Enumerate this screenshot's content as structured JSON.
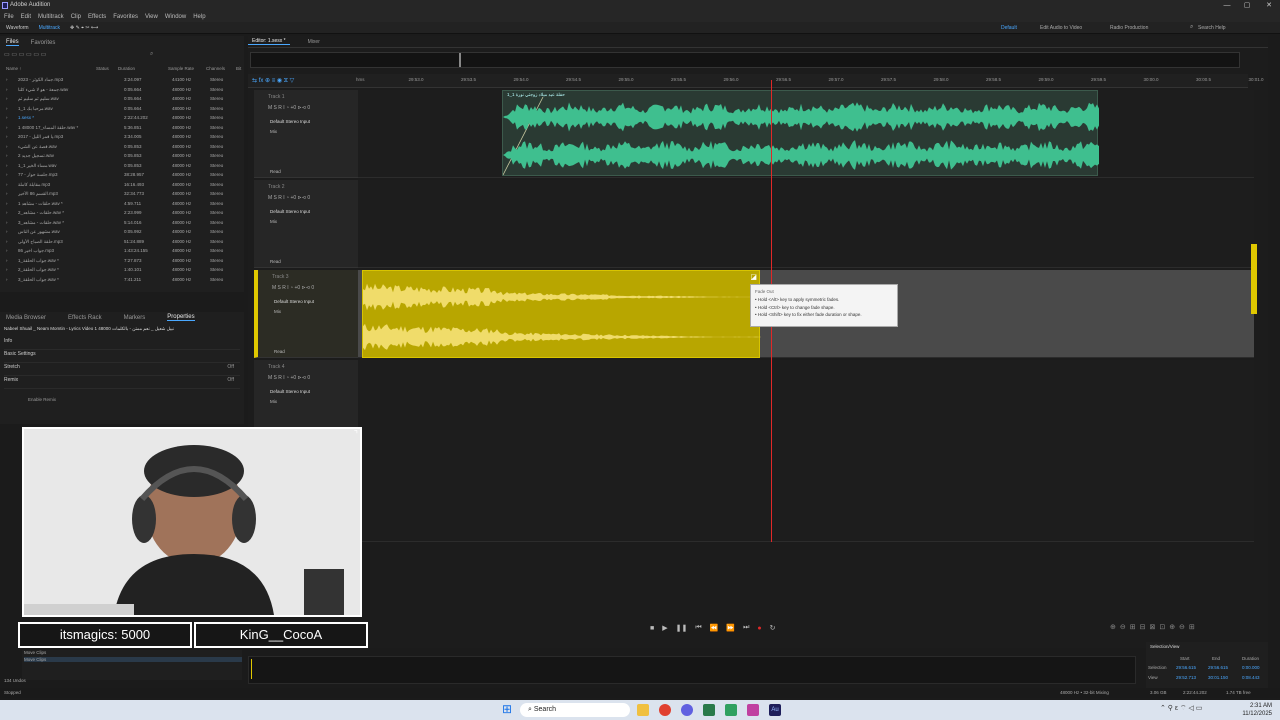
{
  "window": {
    "title": "Adobe Audition",
    "controls": [
      "—",
      "▢",
      "✕"
    ]
  },
  "menu": [
    "File",
    "Edit",
    "Multitrack",
    "Clip",
    "Effects",
    "Favorites",
    "View",
    "Window",
    "Help"
  ],
  "toolbar": {
    "waveform": "Waveform",
    "multitrack": "Multitrack",
    "workspaces": [
      "Default",
      "Edit Audio to Video",
      "Radio Production"
    ],
    "active_workspace": "Default",
    "search_placeholder": "Search Help"
  },
  "files_panel": {
    "tabs": [
      "Files",
      "Favorites"
    ],
    "columns": [
      "Name ↑",
      "Status",
      "Duration",
      "Sample Rate",
      "Channels",
      "Bit"
    ],
    "rows": [
      {
        "name": "2023 - جماد الكوثر.mp3",
        "duration": "3:24.097",
        "rate": "44100 Hz",
        "ch": "Stereo"
      },
      {
        "name": "جمعة - هو لا شيء كلنا.wav",
        "duration": "0:05.664",
        "rate": "48000 Hz",
        "ch": "Stereo"
      },
      {
        "name": "سليم ثم سليم ثم.wav",
        "duration": "0:05.664",
        "rate": "48000 Hz",
        "ch": "Stereo"
      },
      {
        "name": "مرحبا بك 1_1.wav",
        "duration": "0:05.664",
        "rate": "48000 Hz",
        "ch": "Stereo"
      },
      {
        "name": "1.sesx *",
        "duration": "2:22:44.202",
        "rate": "48000 Hz",
        "ch": "Stereo",
        "selected": true
      },
      {
        "name": "1 48000 17_حلقة المساء.wav *",
        "duration": "5:36.851",
        "rate": "48000 Hz",
        "ch": "Stereo"
      },
      {
        "name": "2017 - يا قمر الليل.mp3",
        "duration": "3:34.005",
        "rate": "48000 Hz",
        "ch": "Stereo"
      },
      {
        "name": "قصة عن الشيء.wav",
        "duration": "0:05.853",
        "rate": "48000 Hz",
        "ch": "Stereo"
      },
      {
        "name": "تسجيل جديد 2.wav",
        "duration": "0:05.853",
        "rate": "48000 Hz",
        "ch": "Stereo"
      },
      {
        "name": "1_1 مساء الخير.wav",
        "duration": "0:05.853",
        "rate": "48000 Hz",
        "ch": "Stereo"
      },
      {
        "name": "77 - جلسة حوار.mp3",
        "duration": "38:28.957",
        "rate": "48000 Hz",
        "ch": "Stereo"
      },
      {
        "name": "مقابلة كاملة.mp3",
        "duration": "16:16.493",
        "rate": "48000 Hz",
        "ch": "Stereo"
      },
      {
        "name": "القسم 86 الأخير.mp3",
        "duration": "32:34.773",
        "rate": "48000 Hz",
        "ch": "Stereo"
      },
      {
        "name": "1 حلقات - مشاهد.wav *",
        "duration": "4:59.711",
        "rate": "48000 Hz",
        "ch": "Stereo"
      },
      {
        "name": "2_حلقات - مشاهد.wav *",
        "duration": "2:23.999",
        "rate": "48000 Hz",
        "ch": "Stereo"
      },
      {
        "name": "3_حلقات - مشاهد.wav *",
        "duration": "5:14.016",
        "rate": "48000 Hz",
        "ch": "Stereo"
      },
      {
        "name": "مشهور عن الناس.wav",
        "duration": "0:05.992",
        "rate": "48000 Hz",
        "ch": "Stereo"
      },
      {
        "name": "حلقة الصباح الأولى.mp3",
        "duration": "51:24.889",
        "rate": "48000 Hz",
        "ch": "Stereo"
      },
      {
        "name": "86 جواب أخير.mp3",
        "duration": "1:43:24.155",
        "rate": "48000 Hz",
        "ch": "Stereo"
      },
      {
        "name": "1_جواب الحلقة.wav *",
        "duration": "7:27.873",
        "rate": "48000 Hz",
        "ch": "Stereo"
      },
      {
        "name": "2_جواب الحلقة.wav *",
        "duration": "1:40.101",
        "rate": "48000 Hz",
        "ch": "Stereo"
      },
      {
        "name": "3_جواب الحلقة.wav *",
        "duration": "7:41.211",
        "rate": "48000 Hz",
        "ch": "Stereo"
      }
    ]
  },
  "props_panel": {
    "tabs": [
      "Media Browser",
      "Effects Rack",
      "Markers",
      "Properties"
    ],
    "active_tab": "Properties",
    "clip_name": "Nabeel Shuail _ Neam Momtin - Lyrics Video 1 48000 نبيل شعيل _ نعم ممتن - بالكلمات",
    "sections": [
      "Info",
      "Basic Settings",
      "Stretch",
      "Remix"
    ],
    "stretch_value": "Off",
    "remix_value": "Off",
    "enable_remix": "Enable Remix"
  },
  "editor": {
    "tabs": [
      "Editor: 1.sesx *",
      "Mixer"
    ],
    "ruler": [
      "hms",
      "29:53.0",
      "29:53.5",
      "29:54.0",
      "29:54.5",
      "29:55.0",
      "29:55.5",
      "29:56.0",
      "29:56.5",
      "29:57.0",
      "29:57.5",
      "29:58.0",
      "29:58.5",
      "29:59.0",
      "29:59.5",
      "30:00.0",
      "30:00.5",
      "30:01.0"
    ],
    "tracks": [
      {
        "name": "Track 1",
        "input": "Default Stereo Input",
        "mix": "Mix",
        "mode": "Read",
        "clip_name": "حفلة عيد ميلاد زوجتي نورة 1_1"
      },
      {
        "name": "Track 2",
        "input": "Default Stereo Input",
        "mix": "Mix",
        "mode": "Read"
      },
      {
        "name": "Track 3",
        "input": "Default Stereo Input",
        "mix": "Mix",
        "mode": "Read"
      },
      {
        "name": "Track 4",
        "input": "Default Stereo Input",
        "mix": "Mix",
        "mode": "Read"
      }
    ],
    "track_controls": "M S R I  ◔ +0  ⊳⊲ 0",
    "tooltip": {
      "title": "Fade Out",
      "lines": [
        "• Hold <Alt> key to apply symmetric fades.",
        "• Hold <Ctrl> key to change fade shape.",
        "• Hold <Shift> key to fix either fade duration or shape."
      ]
    },
    "colors": {
      "clip1": "#3fbf8f",
      "clip1_bg": "#2a3a33",
      "clip3": "#b8a600",
      "clip3_wave": "#f0dc6a",
      "playhead": "#e02828",
      "accent": "#4aa8ff"
    }
  },
  "overlay": {
    "bubble_left": "itsmagics: 5000",
    "bubble_right": "KinG__CocoA"
  },
  "history": {
    "items": [
      "Move Clips",
      "Move Clips"
    ],
    "undos": "134 Undos"
  },
  "sel_view": {
    "title": "Selection/View",
    "headers": [
      "Start",
      "End",
      "Duration"
    ],
    "selection": [
      "29:56.615",
      "29:56.615",
      "0:00.000"
    ],
    "view": [
      "29:52.713",
      "30:01.150",
      "0:08.443"
    ]
  },
  "status": {
    "left": "Stopped",
    "right": [
      "48000 Hz • 32-bit Mixing",
      "3.06 GB",
      "2:22:44.202",
      "1.74 TB free"
    ]
  },
  "taskbar": {
    "search": "Search",
    "time": "2:31 AM",
    "date": "11/12/2025"
  }
}
